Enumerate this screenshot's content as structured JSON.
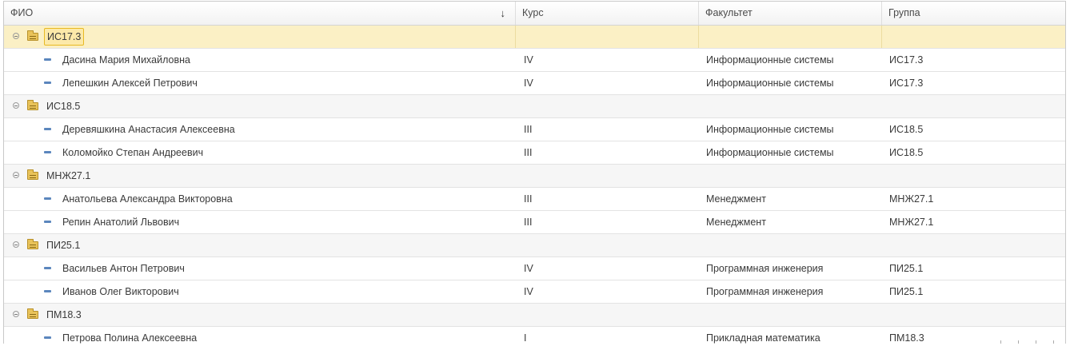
{
  "columns": {
    "fio": "ФИО",
    "kurs": "Курс",
    "faculty": "Факультет",
    "group": "Группа",
    "sort_indicator": "↓"
  },
  "groups": [
    {
      "name": "ИС17.3",
      "selected": true,
      "rows": [
        {
          "fio": "Дасина Мария Михайловна",
          "kurs": "IV",
          "faculty": "Информационные системы",
          "group": "ИС17.3"
        },
        {
          "fio": "Лепешкин Алексей Петрович",
          "kurs": "IV",
          "faculty": "Информационные системы",
          "group": "ИС17.3"
        }
      ]
    },
    {
      "name": "ИС18.5",
      "rows": [
        {
          "fio": "Деревяшкина Анастасия Алексеевна",
          "kurs": "III",
          "faculty": "Информационные системы",
          "group": "ИС18.5"
        },
        {
          "fio": "Коломойко Степан Андреевич",
          "kurs": "III",
          "faculty": "Информационные системы",
          "group": "ИС18.5"
        }
      ]
    },
    {
      "name": "МНЖ27.1",
      "rows": [
        {
          "fio": "Анатольева Александра Викторовна",
          "kurs": "III",
          "faculty": "Менеджмент",
          "group": "МНЖ27.1"
        },
        {
          "fio": "Репин Анатолий Львович",
          "kurs": "III",
          "faculty": "Менеджмент",
          "group": "МНЖ27.1"
        }
      ]
    },
    {
      "name": "ПИ25.1",
      "rows": [
        {
          "fio": "Васильев Антон Петрович",
          "kurs": "IV",
          "faculty": "Программная инженерия",
          "group": "ПИ25.1"
        },
        {
          "fio": "Иванов Олег Викторович",
          "kurs": "IV",
          "faculty": "Программная инженерия",
          "group": "ПИ25.1"
        }
      ]
    },
    {
      "name": "ПМ18.3",
      "rows": [
        {
          "fio": "Петрова Полина Алексеевна",
          "kurs": "I",
          "faculty": "Прикладная математика",
          "group": "ПМ18.3"
        }
      ]
    }
  ],
  "icons": {
    "group_toggle": "collapse-circle-minus-icon",
    "group_folder": "folder-icon",
    "item": "list-item-dash-icon"
  },
  "colors": {
    "selected_row": "#fbf0c5",
    "selected_border": "#e8b923",
    "group_row": "#f6f6f6",
    "item_icon": "#5b86bd",
    "folder": "#e9c35a"
  }
}
